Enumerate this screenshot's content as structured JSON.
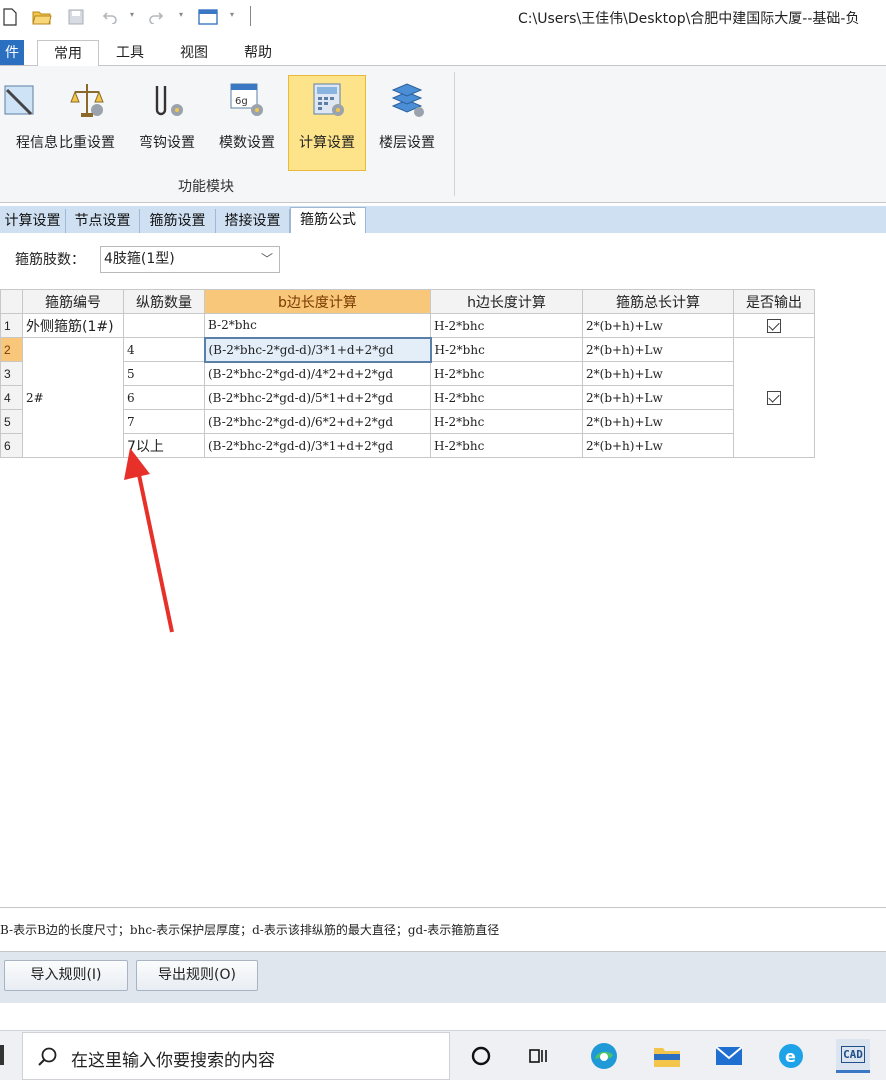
{
  "titlebar": {
    "path": "C:\\Users\\王佳伟\\Desktop\\合肥中建国际大厦--基础-负"
  },
  "ribbon": {
    "tabs": [
      {
        "label": "件"
      },
      {
        "label": "常用"
      },
      {
        "label": "工具"
      },
      {
        "label": "视图"
      },
      {
        "label": "帮助"
      }
    ],
    "buttons": [
      {
        "label": "程信息"
      },
      {
        "label": "比重设置"
      },
      {
        "label": "弯钩设置"
      },
      {
        "label": "模数设置"
      },
      {
        "label": "计算设置"
      },
      {
        "label": "楼层设置"
      }
    ],
    "group_label": "功能模块"
  },
  "settings_tabs": [
    {
      "label": "计算设置"
    },
    {
      "label": "节点设置"
    },
    {
      "label": "箍筋设置"
    },
    {
      "label": "搭接设置"
    },
    {
      "label": "箍筋公式"
    }
  ],
  "legs": {
    "label": "箍筋肢数：",
    "value": "4肢箍(1型)"
  },
  "table": {
    "headers": [
      "",
      "箍筋编号",
      "纵筋数量",
      "b边长度计算",
      "h边长度计算",
      "箍筋总长计算",
      "是否输出"
    ],
    "rows": [
      {
        "num": "1",
        "code": "外侧箍筋(1#)",
        "qty": "",
        "b": "B-2*bhc",
        "h": "H-2*bhc",
        "total": "2*(b+h)+Lw"
      },
      {
        "num": "2",
        "code": "2#",
        "qty": "4",
        "b": "(B-2*bhc-2*gd-d)/3*1+d+2*gd",
        "h": "H-2*bhc",
        "total": "2*(b+h)+Lw"
      },
      {
        "num": "3",
        "code": "",
        "qty": "5",
        "b": "(B-2*bhc-2*gd-d)/4*2+d+2*gd",
        "h": "H-2*bhc",
        "total": "2*(b+h)+Lw"
      },
      {
        "num": "4",
        "code": "",
        "qty": "6",
        "b": "(B-2*bhc-2*gd-d)/5*1+d+2*gd",
        "h": "H-2*bhc",
        "total": "2*(b+h)+Lw"
      },
      {
        "num": "5",
        "code": "",
        "qty": "7",
        "b": "(B-2*bhc-2*gd-d)/6*2+d+2*gd",
        "h": "H-2*bhc",
        "total": "2*(b+h)+Lw"
      },
      {
        "num": "6",
        "code": "",
        "qty": "7以上",
        "b": "(B-2*bhc-2*gd-d)/3*1+d+2*gd",
        "h": "H-2*bhc",
        "total": "2*(b+h)+Lw"
      }
    ],
    "output_checked": [
      true,
      true
    ]
  },
  "legend": "B-表示B边的长度尺寸；bhc-表示保护层厚度；d-表示该排纵筋的最大直径；gd-表示箍筋直径",
  "buttons": {
    "import": "导入规则(I)",
    "export": "导出规则(O)"
  },
  "taskbar": {
    "search_placeholder": "在这里输入你要搜索的内容",
    "app_badge": "CAD"
  },
  "colors": {
    "accent": "#2b6fc0",
    "active_button": "#fde48a",
    "header_highlight": "#f8c77a",
    "tab_strip": "#cfe0f2",
    "arrow": "#e8302a"
  }
}
